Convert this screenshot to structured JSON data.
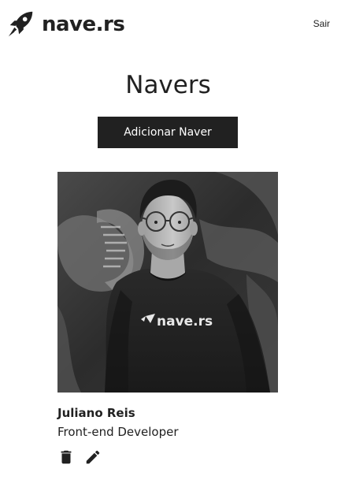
{
  "header": {
    "logo_text": "nave.rs",
    "signout_label": "Sair"
  },
  "main": {
    "title": "Navers",
    "add_button_label": "Adicionar Naver"
  },
  "navers": [
    {
      "name": "Juliano Reis",
      "job_role": "Front-end Developer",
      "shirt_text": "nave.rs",
      "icons": {
        "delete": "trash-icon",
        "edit": "pencil-icon"
      }
    }
  ],
  "colors": {
    "text": "#212121",
    "button_bg": "#212121",
    "button_text": "#ffffff",
    "background": "#ffffff"
  }
}
